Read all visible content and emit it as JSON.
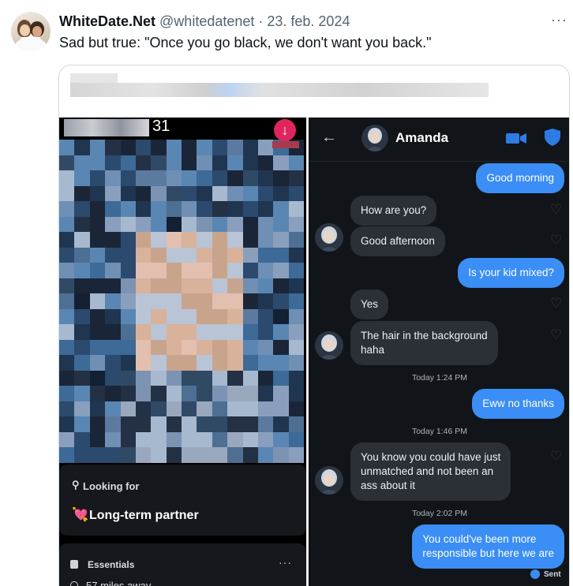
{
  "tweet": {
    "author_name": "WhiteDate.Net",
    "meta": "@whitedatenet · 23. feb. 2024",
    "more_icon": "more-horizontal-icon",
    "text": "Sad but true: \"Once you go black, we don't want you back.\""
  },
  "profile": {
    "age": "31",
    "looking_for_label": "Looking for",
    "looking_for_value": "Long-term partner",
    "essentials_label": "Essentials",
    "distance": "57 miles away"
  },
  "chat": {
    "contact_name": "Amanda",
    "messages": [
      {
        "dir": "out",
        "text": "Good morning"
      },
      {
        "dir": "in",
        "text": "How are you?"
      },
      {
        "dir": "in",
        "text": "Good afternoon"
      },
      {
        "dir": "out",
        "text": "Is your kid mixed?"
      },
      {
        "dir": "in",
        "text": "Yes"
      },
      {
        "dir": "in",
        "text": "The hair in the background\nhaha"
      },
      {
        "dir": "ts",
        "text": "Today 1:24 PM"
      },
      {
        "dir": "out",
        "text": "Eww no thanks"
      },
      {
        "dir": "ts",
        "text": "Today 1:46 PM"
      },
      {
        "dir": "in",
        "text": "You know you could have just\nunmatched and not been an\nass about it"
      },
      {
        "dir": "ts",
        "text": "Today 2:02 PM"
      },
      {
        "dir": "out",
        "text": "You could've been more\nresponsible but here we are"
      }
    ],
    "sent_label": "Sent"
  },
  "colors": {
    "accent_blue": "#3a8ef5",
    "chat_bg": "#111418",
    "bubble_in": "#2b2f36"
  }
}
